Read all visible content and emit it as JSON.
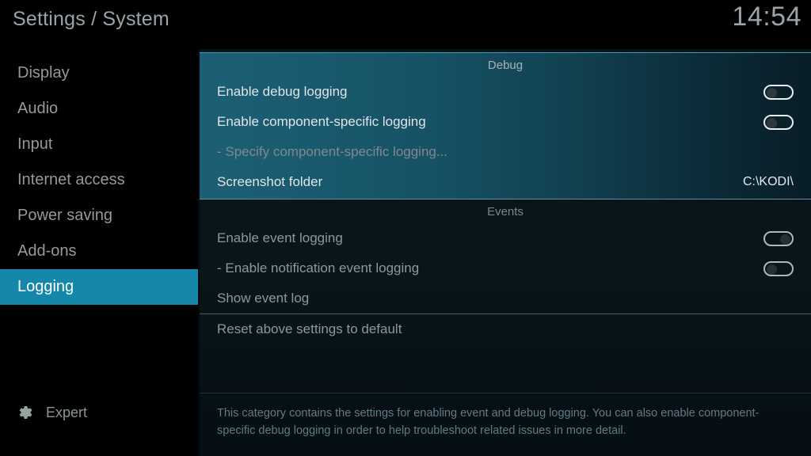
{
  "header": {
    "title": "Settings / System",
    "clock": "14:54"
  },
  "sidebar": {
    "items": [
      {
        "label": "Display",
        "selected": false
      },
      {
        "label": "Audio",
        "selected": false
      },
      {
        "label": "Input",
        "selected": false
      },
      {
        "label": "Internet access",
        "selected": false
      },
      {
        "label": "Power saving",
        "selected": false
      },
      {
        "label": "Add-ons",
        "selected": false
      },
      {
        "label": "Logging",
        "selected": true
      }
    ],
    "level": {
      "label": "Expert",
      "icon": "gear-icon"
    },
    "selected_color": "#1487ab"
  },
  "content": {
    "groups": [
      {
        "name": "debug",
        "heading": "Debug",
        "highlighted": true,
        "rows": [
          {
            "label": "Enable debug logging",
            "control": "toggle",
            "state": "off",
            "enabled": true
          },
          {
            "label": "Enable component-specific logging",
            "control": "toggle",
            "state": "off",
            "enabled": true
          },
          {
            "label": "- Specify component-specific logging...",
            "control": "none",
            "enabled": false
          },
          {
            "label": "Screenshot folder",
            "control": "value",
            "value": "C:\\KODI\\",
            "enabled": true
          }
        ]
      },
      {
        "name": "events",
        "heading": "Events",
        "highlighted": false,
        "rows": [
          {
            "label": "Enable event logging",
            "control": "toggle",
            "state": "on",
            "enabled": true
          },
          {
            "label": "- Enable notification event logging",
            "control": "toggle",
            "state": "off",
            "enabled": true
          },
          {
            "label": "Show event log",
            "control": "none",
            "enabled": true
          },
          {
            "label": "Reset above settings to default",
            "control": "none",
            "enabled": true,
            "divider_above": true
          }
        ]
      }
    ]
  },
  "footer": {
    "description": "This category contains the settings for enabling event and debug logging. You can also enable component-specific debug logging in order to help troubleshoot related issues in more detail."
  }
}
